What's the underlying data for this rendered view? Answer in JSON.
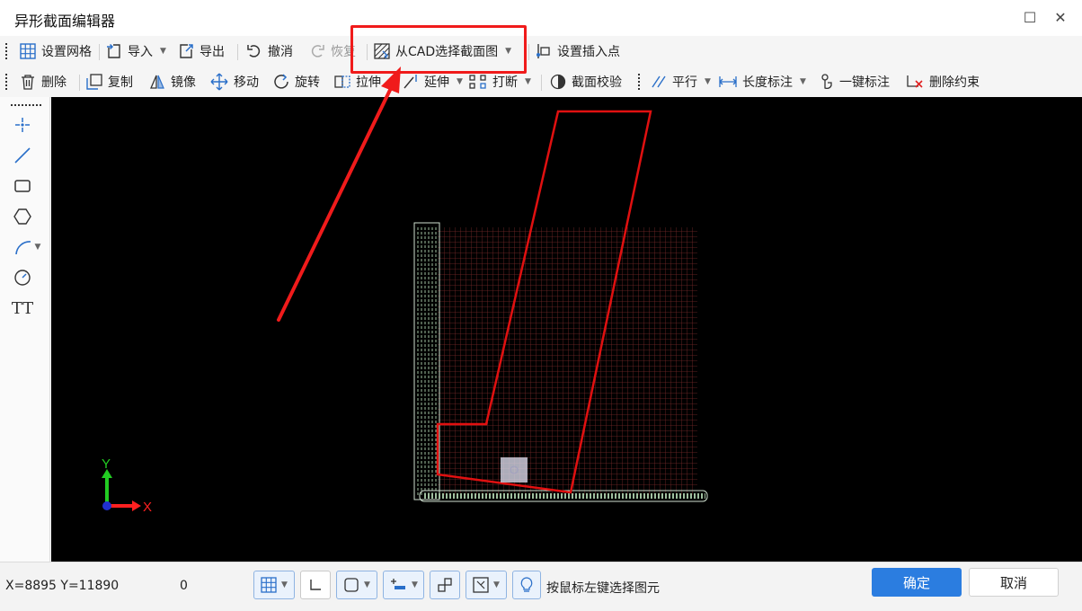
{
  "window": {
    "title": "异形截面编辑器",
    "maximize": "☐",
    "close": "✕"
  },
  "toolbar1": {
    "grid": "设置网格",
    "import": "导入",
    "export": "导出",
    "undo": "撤消",
    "redo": "恢复",
    "from_cad": "从CAD选择截面图",
    "insert_point": "设置插入点"
  },
  "toolbar2": {
    "delete": "删除",
    "copy": "复制",
    "mirror": "镜像",
    "move": "移动",
    "rotate": "旋转",
    "stretch": "拉伸",
    "extend": "延伸",
    "break": "打断",
    "check": "截面校验",
    "parallel": "平行",
    "length_dim": "长度标注",
    "auto_dim": "一键标注",
    "del_constraint": "删除约束"
  },
  "left_tools": [
    "point-tool",
    "line-tool",
    "rectangle-tool",
    "polygon-tool",
    "arc-tool",
    "circle-tool",
    "text-tool"
  ],
  "left_text_icon": "TT",
  "axis": {
    "x": "X",
    "y": "Y"
  },
  "status": {
    "coords": "X=8895 Y=11890",
    "value": "0",
    "hint": "按鼠标左键选择图元"
  },
  "buttons": {
    "ok": "确定",
    "cancel": "取消"
  },
  "colors": {
    "accent": "#2b7de0",
    "highlight": "#f01b1b",
    "section_outline": "#e01010",
    "grid": "#7a2a2a"
  }
}
